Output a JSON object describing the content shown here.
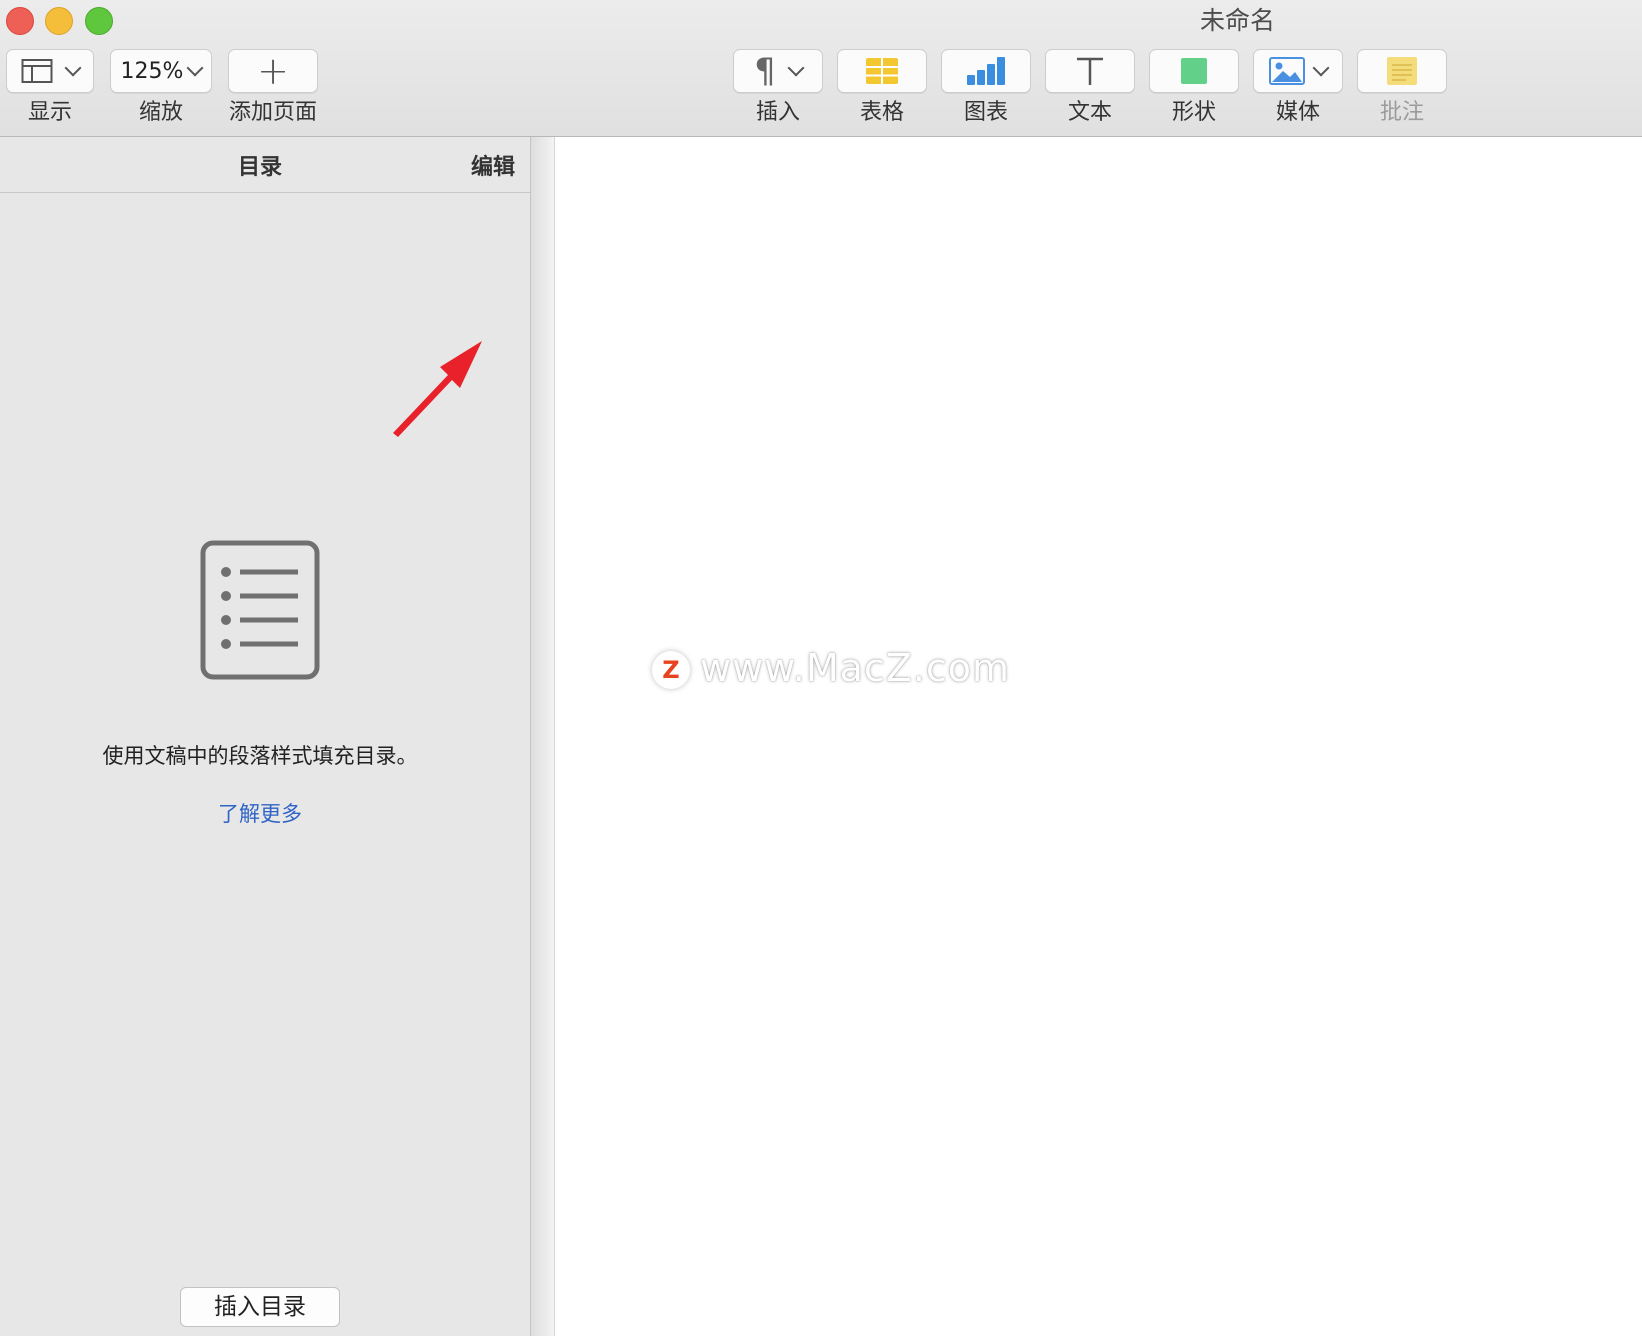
{
  "window": {
    "title": "未命名"
  },
  "toolbar": {
    "left": [
      {
        "label": "显示",
        "icon": "sidebar-view-icon"
      },
      {
        "label": "缩放",
        "value": "125%"
      },
      {
        "label": "添加页面",
        "icon": "plus-icon"
      }
    ],
    "right": [
      {
        "label": "插入",
        "icon": "pilcrow-icon"
      },
      {
        "label": "表格",
        "icon": "table-icon",
        "color": "#f2c72f"
      },
      {
        "label": "图表",
        "icon": "chart-icon",
        "color": "#3b8de0"
      },
      {
        "label": "文本",
        "icon": "text-icon"
      },
      {
        "label": "形状",
        "icon": "shape-icon",
        "color": "#63d08a"
      },
      {
        "label": "媒体",
        "icon": "media-icon",
        "color": "#4a90e2"
      },
      {
        "label": "批注",
        "icon": "comment-icon",
        "color": "#f5dc7a"
      }
    ]
  },
  "sidebar": {
    "title": "目录",
    "edit_label": "编辑",
    "empty_message": "使用文稿中的段落样式填充目录。",
    "learn_more": "了解更多",
    "insert_button": "插入目录"
  },
  "watermark": {
    "logo_letter": "Z",
    "text": "www.MacZ.com"
  },
  "colors": {
    "accent_link": "#2f64c5",
    "annotation_arrow": "#e8212b"
  }
}
